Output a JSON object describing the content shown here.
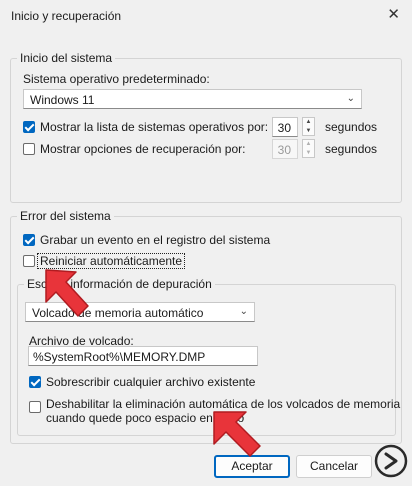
{
  "window": {
    "title": "Inicio y recuperación",
    "close_glyph": "✕"
  },
  "startup": {
    "legend": "Inicio del sistema",
    "default_os_label": "Sistema operativo predeterminado:",
    "default_os_value": "Windows 11",
    "show_list_label": "Mostrar la lista de sistemas operativos por:",
    "show_list_checked": true,
    "show_list_seconds": "30",
    "show_recovery_label": "Mostrar opciones de recuperación por:",
    "show_recovery_checked": false,
    "show_recovery_seconds": "30",
    "seconds_unit": "segundos"
  },
  "system_failure": {
    "legend": "Error del sistema",
    "write_event_label": "Grabar un evento en el registro del sistema",
    "write_event_checked": true,
    "auto_restart_label": "Reiniciar automáticamente",
    "auto_restart_checked": false,
    "debug": {
      "legend": "Escribir información de depuración",
      "dump_type_value": "Volcado de memoria automático",
      "dump_file_label": "Archivo de volcado:",
      "dump_file_value": "%SystemRoot%\\MEMORY.DMP",
      "overwrite_label": "Sobrescribir cualquier archivo existente",
      "overwrite_checked": true,
      "disable_auto_delete_label_line1": "Deshabilitar la eliminación automática de los volcados de memoria",
      "disable_auto_delete_label_line2": "cuando quede poco espacio en disco",
      "disable_auto_delete_checked": false
    }
  },
  "buttons": {
    "ok": "Aceptar",
    "cancel": "Cancelar"
  },
  "colors": {
    "accent": "#0067c0",
    "arrow": "#e8343a"
  }
}
